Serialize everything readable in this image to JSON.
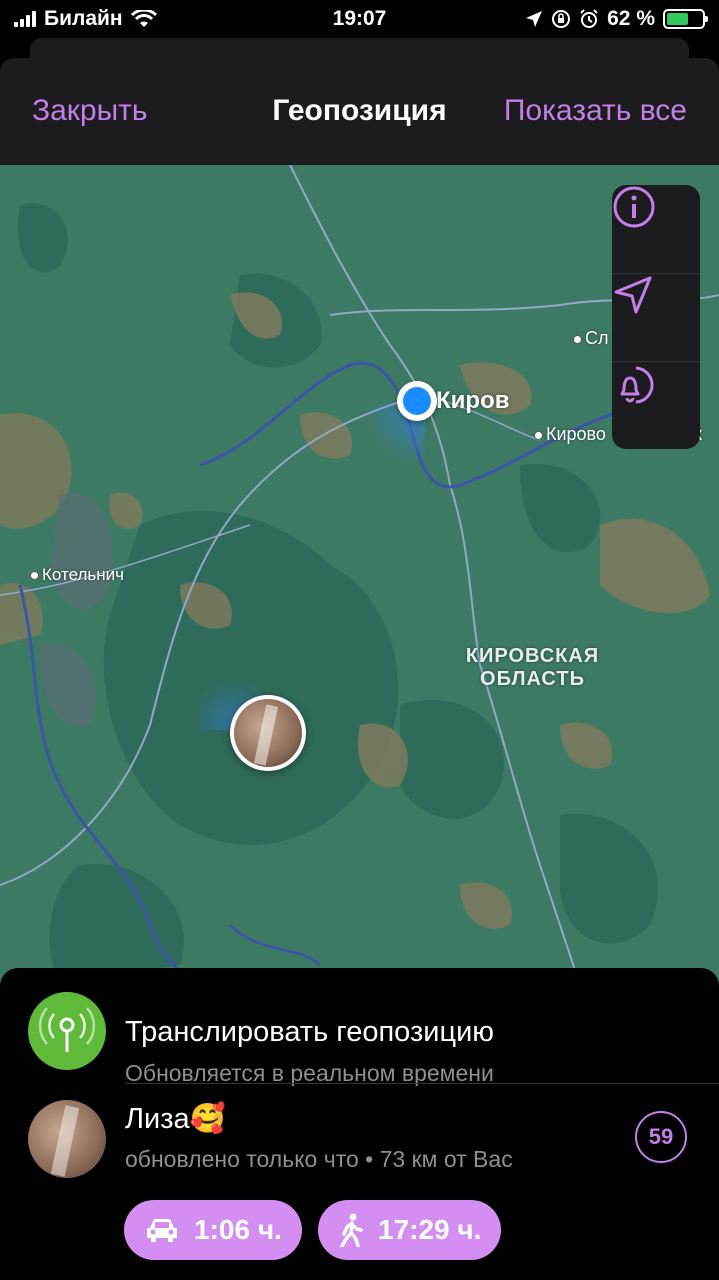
{
  "status": {
    "carrier": "Билайн",
    "time": "19:07",
    "battery_percent": "62 %",
    "battery_level": 0.62,
    "colors": {
      "battery": "#34c759"
    }
  },
  "nav": {
    "close_label": "Закрыть",
    "title": "Геопозиция",
    "show_all_label": "Показать все"
  },
  "accent_color": "#c47ee8",
  "map": {
    "labels": {
      "kirov": "Киров",
      "kotelnich": "Котельнич",
      "slobodskoy": "Сл",
      "kirovo_chepetsk": "Кирово",
      "kirovo_chepetsk_tail": "к",
      "region_line1": "КИРОВСКАЯ",
      "region_line2": "ОБЛАСТЬ"
    },
    "controls": [
      "info-icon",
      "location-arrow-icon",
      "proximity-alert-icon"
    ]
  },
  "live": {
    "title": "Транслировать геопозицию",
    "subtitle": "Обновляется в реальном времени"
  },
  "contact": {
    "name": "Лиза🥰",
    "updated": "обновлено только что",
    "distance": "73 км от Вас",
    "timer": "59",
    "drive_time": "1:06 ч.",
    "walk_time": "17:29 ч."
  }
}
